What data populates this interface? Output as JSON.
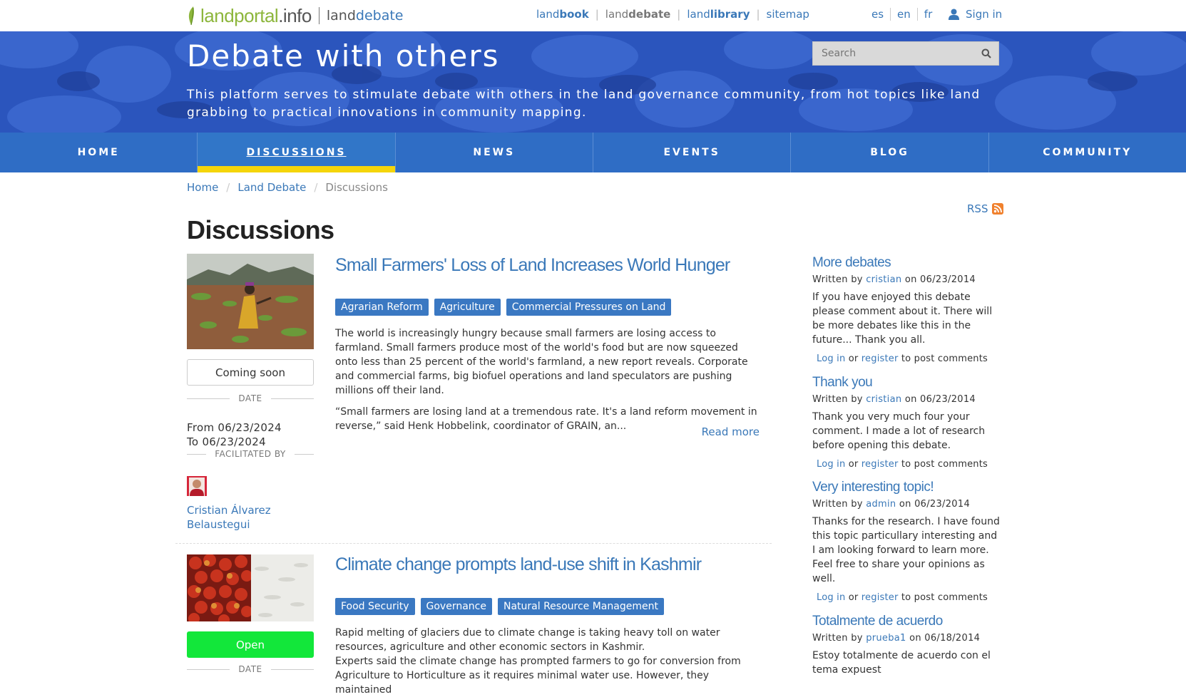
{
  "topbar": {
    "logo_lp": "landportal",
    "logo_tld": ".info",
    "logo_sub_a": "land",
    "logo_sub_b": "debate",
    "nav": [
      {
        "a": "land",
        "b": "book"
      },
      {
        "a": "land",
        "b": "debate"
      },
      {
        "a": "land",
        "b": "library"
      },
      {
        "a": "sitemap",
        "b": ""
      }
    ],
    "langs": [
      "es",
      "en",
      "fr"
    ],
    "signin": "Sign in"
  },
  "hero": {
    "title": "Debate with others",
    "description": "This platform serves to stimulate debate with others in the land governance community, from hot topics like land grabbing to practical innovations in community mapping.",
    "search_placeholder": "Search"
  },
  "mainnav": [
    "HOME",
    "DISCUSSIONS",
    "NEWS",
    "EVENTS",
    "BLOG",
    "COMMUNITY"
  ],
  "breadcrumb": [
    "Home",
    "Land Debate",
    "Discussions"
  ],
  "rss": "RSS",
  "page_title": "Discussions",
  "discussions": [
    {
      "title": "Small Farmers' Loss of Land Increases World Hunger",
      "tags": [
        "Agrarian Reform",
        "Agriculture",
        "Commercial Pressures on Land"
      ],
      "status": "Coming soon",
      "date_label": "DATE",
      "from": "From 06/23/2024",
      "to": "To 06/23/2024",
      "facilitated_label": "FACILITATED BY",
      "facilitator": "Cristian Álvarez Belaustegui",
      "p1": "The world is increasingly hungry because small farmers are losing access to farmland. Small farmers produce most of the world's food but are now squeezed onto less than 25 percent of the world's farmland, a new report reveals. Corporate and commercial farms, big biofuel operations and land speculators are pushing millions off their land.",
      "p2": "“Small farmers are losing land at a tremendous rate. It's a land reform movement in reverse,” said Henk Hobbelink, coordinator of GRAIN, an...",
      "read_more": "Read more"
    },
    {
      "title": "Climate change prompts land-use shift in Kashmir",
      "tags": [
        "Food Security",
        "Governance",
        "Natural Resource Management"
      ],
      "status": "Open",
      "date_label": "DATE",
      "p1": "Rapid melting of glaciers due to climate change is taking heavy toll on water resources, agriculture and other economic sectors in Kashmir.",
      "p2": "Experts said the climate change has prompted farmers to go for conversion from Agriculture to Horticulture as it requires minimal water use. However, they maintained"
    }
  ],
  "sidebar": {
    "comments": [
      {
        "title": "More debates",
        "written_by": "Written by",
        "author": "cristian",
        "on": "on 06/23/2014",
        "body": "If you have enjoyed this debate please comment about it. There will be more debates like this in the future... Thank you all.",
        "login": "Log in",
        "or": "or",
        "register": "register",
        "tail": "to post comments"
      },
      {
        "title": "Thank you",
        "written_by": "Written by",
        "author": "cristian",
        "on": "on 06/23/2014",
        "body": "Thank you very much four your comment. I made a lot of research before opening this debate.",
        "login": "Log in",
        "or": "or",
        "register": "register",
        "tail": "to post comments"
      },
      {
        "title": "Very interesting topic!",
        "written_by": "Written by",
        "author": "admin",
        "on": "on 06/23/2014",
        "body": "Thanks for the research. I have found this topic particullary interesting and I am looking forward to learn more. Feel free to share your opinions as well.",
        "login": "Log in",
        "or": "or",
        "register": "register",
        "tail": "to post comments"
      },
      {
        "title": "Totalmente de acuerdo",
        "written_by": "Written by",
        "author": "prueba1",
        "on": "on 06/18/2014",
        "body": "Estoy totalmente de acuerdo con el tema expuest"
      }
    ]
  },
  "colors": {
    "nav_bg": "#2f6dc5",
    "accent_yellow": "#f5d50a",
    "open_green": "#12e73a",
    "link_blue": "#3a78b8",
    "tag_blue": "#3a78c2"
  },
  "icons": [
    "leaf-logo-icon",
    "user-icon",
    "search-icon",
    "rss-icon"
  ]
}
